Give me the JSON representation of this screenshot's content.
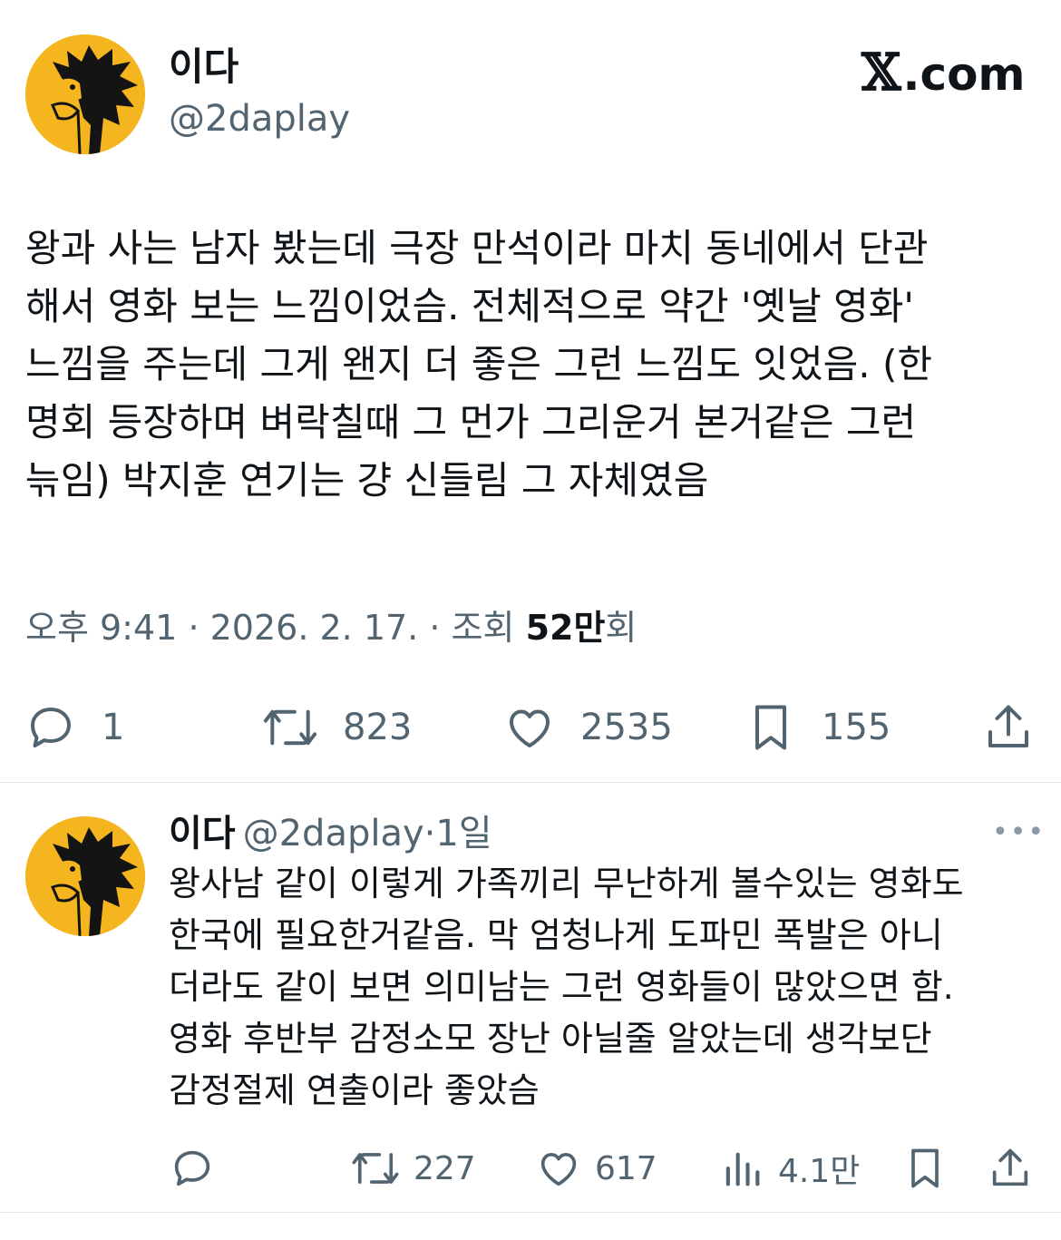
{
  "main_tweet": {
    "author_name": "이다",
    "author_handle": "@2daplay",
    "brand": {
      "mark": "𝕏",
      "suffix": ".com"
    },
    "text": "왕과 사는 남자 봤는데 극장 만석이라 마치 동네에서 단관\n해서 영화 보는 느낌이었슴. 전체적으로 약간 '옛날 영화'\n느낌을 주는데 그게 왠지 더 좋은 그런 느낌도 잇었음. (한\n명회 등장하며 벼락칠때 그 먼가 그리운거 본거같은 그런\n늒임) 박지훈 연기는 걍 신들림 그 자체였음",
    "meta": {
      "time": "오후 9:41",
      "sep": "·",
      "date": "2026. 2. 17.",
      "views_prefix": "조회",
      "views_count": "52만",
      "views_suffix": "회"
    },
    "actions": {
      "replies": "1",
      "reposts": "823",
      "likes": "2535",
      "bookmarks": "155"
    }
  },
  "reply_tweet": {
    "author_name": "이다",
    "author_handle": "@2daplay",
    "time_sep": "·",
    "time": "1일",
    "more": "•••",
    "text": "왕사남 같이 이렇게 가족끼리 무난하게 볼수있는 영화도\n한국에 필요한거같음. 막 엄청나게 도파민 폭발은 아니\n더라도 같이 보면 의미남는 그런 영화들이 많았으면 함.\n영화 후반부 감정소모 장난 아닐줄 알았는데 생각보단\n감정절제 연출이라 좋았슴",
    "actions": {
      "reposts": "227",
      "likes": "617",
      "views": "4.1만"
    }
  },
  "colors": {
    "text": "#0f1419",
    "secondary": "#536471",
    "avatar_bg": "#f4b51f",
    "divider": "#e6e9ec"
  },
  "icons": [
    "reply-icon",
    "repost-icon",
    "like-icon",
    "bookmark-icon",
    "share-icon",
    "views-icon",
    "more-icon"
  ]
}
